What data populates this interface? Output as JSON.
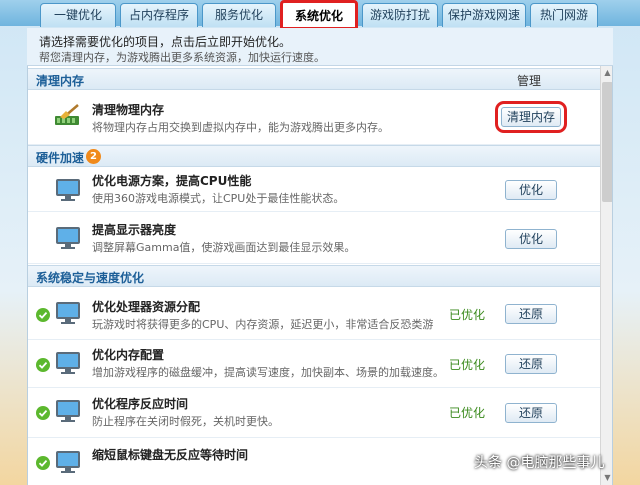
{
  "tabs": [
    {
      "label": "一键优化"
    },
    {
      "label": "占内存程序"
    },
    {
      "label": "服务优化"
    },
    {
      "label": "系统优化"
    },
    {
      "label": "游戏防打扰"
    },
    {
      "label": "保护游戏网速"
    },
    {
      "label": "热门网游"
    }
  ],
  "active_tab": "系统优化",
  "notice": {
    "line1": "请选择需要优化的项目，点击后立即开始优化。",
    "line2": "帮您清理内存，为游戏腾出更多系统资源，加快运行速度。"
  },
  "sections": {
    "clean": {
      "title": "清理内存",
      "manage": "管理"
    },
    "hardware": {
      "title": "硬件加速",
      "badge": "2"
    },
    "system": {
      "title": "系统稳定与速度优化"
    }
  },
  "items": {
    "clean_mem": {
      "name": "清理物理内存",
      "desc": "将物理内存占用交换到虚拟内存中，能为游戏腾出更多内存。",
      "button": "清理内存"
    },
    "power": {
      "name": "优化电源方案，提高CPU性能",
      "desc": "使用360游戏电源模式，让CPU处于最佳性能状态。",
      "button": "优化"
    },
    "brightness": {
      "name": "提高显示器亮度",
      "desc": "调整屏幕Gamma值，使游戏画面达到最佳显示效果。",
      "button": "优化"
    },
    "cpu": {
      "name": "优化处理器资源分配",
      "desc": "玩游戏时将获得更多的CPU、内存资源，延迟更小，非常适合反恐类游",
      "status": "已优化",
      "button": "还原"
    },
    "memcfg": {
      "name": "优化内存配置",
      "desc": "增加游戏程序的磁盘缓冲，提高读写速度，加快副本、场景的加载速度。",
      "status": "已优化",
      "button": "还原"
    },
    "response": {
      "name": "优化程序反应时间",
      "desc": "防止程序在关闭时假死，关机时更快。",
      "status": "已优化",
      "button": "还原"
    },
    "mouse": {
      "name": "缩短鼠标键盘无反应等待时间"
    }
  },
  "watermark": "头条 @电脑那些事儿"
}
